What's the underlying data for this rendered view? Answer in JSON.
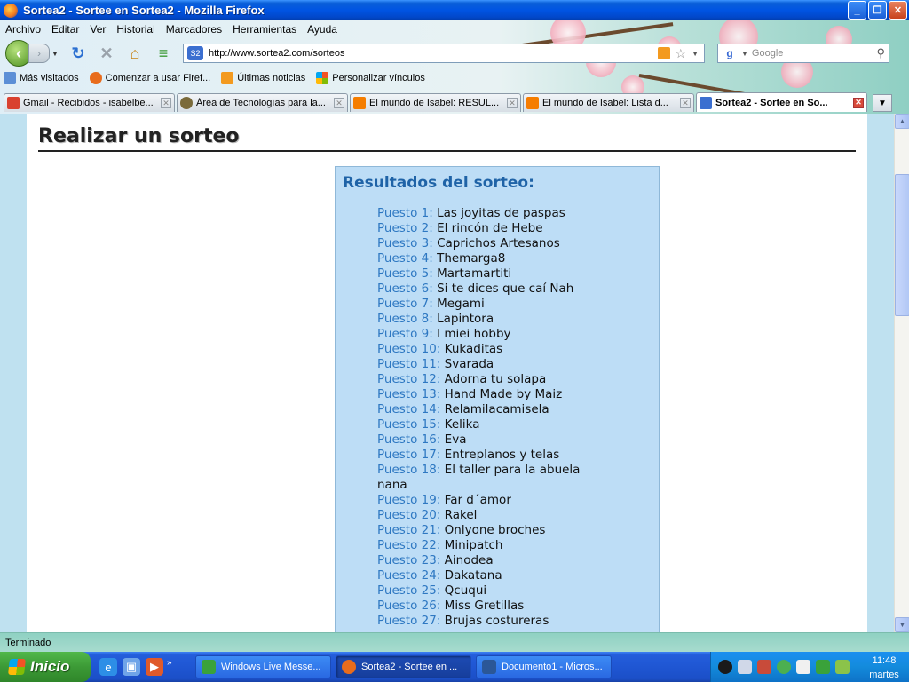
{
  "window": {
    "title": "Sortea2 - Sortee en Sortea2 - Mozilla Firefox",
    "controls": {
      "minimize": "_",
      "maximize": "❐",
      "close": "✕"
    }
  },
  "menu": [
    "Archivo",
    "Editar",
    "Ver",
    "Historial",
    "Marcadores",
    "Herramientas",
    "Ayuda"
  ],
  "nav": {
    "url": "http://www.sortea2.com/sorteos",
    "search_placeholder": "Google"
  },
  "bookmarks": [
    "Más visitados",
    "Comenzar a usar Firef...",
    "Últimas noticias",
    "Personalizar vínculos"
  ],
  "tabs": [
    {
      "label": "Gmail - Recibidos - isabelbe...",
      "icon": "gmail-icon",
      "color": "#d9412f"
    },
    {
      "label": "Área de Tecnologías para la...",
      "icon": "site-icon",
      "color": "#7a6a3a"
    },
    {
      "label": "El mundo de Isabel: RESUL...",
      "icon": "blogger-icon",
      "color": "#f57d00"
    },
    {
      "label": "El mundo de Isabel: Lista d...",
      "icon": "blogger-icon",
      "color": "#f57d00"
    },
    {
      "label": "Sortea2 - Sortee en So...",
      "icon": "sortea2-icon",
      "color": "#3b6fd0",
      "active": true
    }
  ],
  "page": {
    "title": "Realizar un sorteo",
    "results_heading": "Resultados del sorteo:",
    "results": [
      {
        "label": "Puesto 1:",
        "name": "Las joyitas de paspas"
      },
      {
        "label": "Puesto 2:",
        "name": "El rincón de Hebe"
      },
      {
        "label": "Puesto 3:",
        "name": "Caprichos Artesanos"
      },
      {
        "label": "Puesto 4:",
        "name": "Themarga8"
      },
      {
        "label": "Puesto 5:",
        "name": "Martamartiti"
      },
      {
        "label": "Puesto 6:",
        "name": "Si te dices que caí Nah"
      },
      {
        "label": "Puesto 7:",
        "name": "Megami"
      },
      {
        "label": "Puesto 8:",
        "name": "Lapintora"
      },
      {
        "label": "Puesto 9:",
        "name": "I miei hobby"
      },
      {
        "label": "Puesto 10:",
        "name": "Kukaditas"
      },
      {
        "label": "Puesto 11:",
        "name": "Svarada"
      },
      {
        "label": "Puesto 12:",
        "name": "Adorna tu solapa"
      },
      {
        "label": "Puesto 13:",
        "name": "Hand Made by Maiz"
      },
      {
        "label": "Puesto 14:",
        "name": "Relamilacamisela"
      },
      {
        "label": "Puesto 15:",
        "name": "Kelika"
      },
      {
        "label": "Puesto 16:",
        "name": "Eva"
      },
      {
        "label": "Puesto 17:",
        "name": "Entreplanos y telas"
      },
      {
        "label": "Puesto 18:",
        "name": "El taller para la abuela nana"
      },
      {
        "label": "Puesto 19:",
        "name": "Far d´amor"
      },
      {
        "label": "Puesto 20:",
        "name": "Rakel"
      },
      {
        "label": "Puesto 21:",
        "name": "Onlyone broches"
      },
      {
        "label": "Puesto 22:",
        "name": "Minipatch"
      },
      {
        "label": "Puesto 23:",
        "name": "Ainodea"
      },
      {
        "label": "Puesto 24:",
        "name": "Dakatana"
      },
      {
        "label": "Puesto 25:",
        "name": "Qcuqui"
      },
      {
        "label": "Puesto 26:",
        "name": "Miss Gretillas"
      },
      {
        "label": "Puesto 27:",
        "name": "Brujas costureras"
      }
    ]
  },
  "status": "Terminado",
  "taskbar": {
    "start": "Inicio",
    "tasks": [
      {
        "label": "Windows Live Messe...",
        "icon": "messenger-icon",
        "color": "#3aa23a"
      },
      {
        "label": "Sortea2 - Sortee en ...",
        "icon": "firefox-icon",
        "color": "#e86c1c",
        "active": true
      },
      {
        "label": "Documento1 - Micros...",
        "icon": "word-icon",
        "color": "#2b5797"
      }
    ],
    "clock_time": "11:48",
    "clock_day": "martes"
  },
  "colors": {
    "puesto_label": "#2e78c2",
    "results_heading": "#1f63a7",
    "results_box": "#bdddf6",
    "page_background": "#bfe1f0"
  }
}
